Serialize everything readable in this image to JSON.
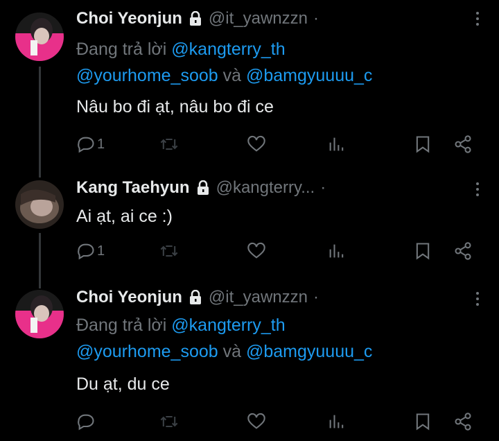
{
  "tweets": [
    {
      "name": "Choi Yeonjun",
      "handle": "@it_yawnzzn",
      "dot": "·",
      "reply_prefix": "Đang trả lời ",
      "reply_m1": "@kangterry_th",
      "reply_m2": "@yourhome_soob",
      "reply_and": " và ",
      "reply_m3": "@bamgyuuuu_c",
      "text": "Nâu bo đi ạt, nâu bo đi ce",
      "reply_count": "1"
    },
    {
      "name": "Kang Taehyun",
      "handle": "@kangterry...",
      "dot": "·",
      "text": "Ai ạt, ai ce :)",
      "reply_count": "1"
    },
    {
      "name": "Choi Yeonjun",
      "handle": "@it_yawnzzn",
      "dot": "·",
      "reply_prefix": "Đang trả lời ",
      "reply_m1": "@kangterry_th",
      "reply_m2": "@yourhome_soob",
      "reply_and": " và ",
      "reply_m3": "@bamgyuuuu_c",
      "text": "Du ạt, du ce",
      "reply_count": ""
    }
  ],
  "colors": {
    "background": "#000000",
    "text": "#e7e9ea",
    "muted": "#71767b",
    "mention": "#1d9bf0",
    "avatar_pink": "#e8308a"
  },
  "icons": [
    "lock-icon",
    "more-icon",
    "reply-icon",
    "retweet-icon",
    "like-icon",
    "views-icon",
    "bookmark-icon",
    "share-icon"
  ]
}
